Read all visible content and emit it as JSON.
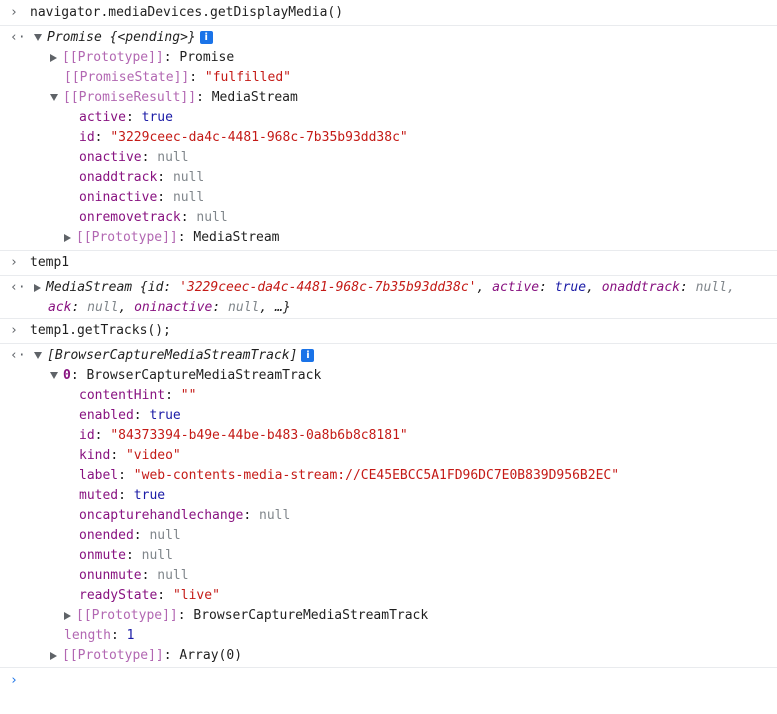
{
  "cmd1": {
    "text": "navigator.mediaDevices.getDisplayMedia()"
  },
  "promise": {
    "label": "Promise",
    "pending": "{<pending>}",
    "prototype_key": "[[Prototype]]",
    "prototype_val": "Promise",
    "state_key": "[[PromiseState]]",
    "state_val": "\"fulfilled\"",
    "result_key": "[[PromiseResult]]",
    "result_val": "MediaStream"
  },
  "stream": {
    "props": [
      {
        "key": "active",
        "val": "true",
        "type": "kw"
      },
      {
        "key": "id",
        "val": "\"3229ceec-da4c-4481-968c-7b35b93dd38c\"",
        "type": "str"
      },
      {
        "key": "onactive",
        "val": "null",
        "type": "nul"
      },
      {
        "key": "onaddtrack",
        "val": "null",
        "type": "nul"
      },
      {
        "key": "oninactive",
        "val": "null",
        "type": "nul"
      },
      {
        "key": "onremovetrack",
        "val": "null",
        "type": "nul"
      }
    ],
    "prototype_key": "[[Prototype]]",
    "prototype_val": "MediaStream"
  },
  "cmd2": {
    "text": "temp1"
  },
  "temp1_result": {
    "line1_prefix": "MediaStream {id: ",
    "line1_id": "'3229ceec-da4c-4481-968c-7b35b93dd38c'",
    "line1_active_key": "active",
    "line1_active_val": "true",
    "line1_onaddtrack_key": "onaddtrack",
    "line1_onaddtrack_val": "null,",
    "line2_prefix": "ack",
    "line2_null1": "null",
    "line2_oninactive_key": "oninactive",
    "line2_null2": "null",
    "line2_more": "…}"
  },
  "cmd3": {
    "text": "temp1.getTracks();"
  },
  "tracks": {
    "label": "[BrowserCaptureMediaStreamTrack]",
    "index_key": "0",
    "index_val": "BrowserCaptureMediaStreamTrack",
    "props": [
      {
        "key": "contentHint",
        "val": "\"\"",
        "type": "str"
      },
      {
        "key": "enabled",
        "val": "true",
        "type": "kw"
      },
      {
        "key": "id",
        "val": "\"84373394-b49e-44be-b483-0a8b6b8c8181\"",
        "type": "str"
      },
      {
        "key": "kind",
        "val": "\"video\"",
        "type": "str"
      },
      {
        "key": "label",
        "val": "\"web-contents-media-stream://CE45EBCC5A1FD96DC7E0B839D956B2EC\"",
        "type": "str"
      },
      {
        "key": "muted",
        "val": "true",
        "type": "kw"
      },
      {
        "key": "oncapturehandlechange",
        "val": "null",
        "type": "nul"
      },
      {
        "key": "onended",
        "val": "null",
        "type": "nul"
      },
      {
        "key": "onmute",
        "val": "null",
        "type": "nul"
      },
      {
        "key": "onunmute",
        "val": "null",
        "type": "nul"
      },
      {
        "key": "readyState",
        "val": "\"live\"",
        "type": "str"
      }
    ],
    "track_proto_key": "[[Prototype]]",
    "track_proto_val": "BrowserCaptureMediaStreamTrack",
    "length_key": "length",
    "length_val": "1",
    "array_proto_key": "[[Prototype]]",
    "array_proto_val": "Array(0)"
  },
  "icons": {
    "prompt": "prompt-chevron-icon",
    "result": "result-arrow-icon",
    "info": "info-icon"
  },
  "colors": {
    "key": "#881280",
    "string": "#c41a16",
    "keyword": "#1a1aa6",
    "null": "#80868b",
    "info": "#1a73e8"
  }
}
